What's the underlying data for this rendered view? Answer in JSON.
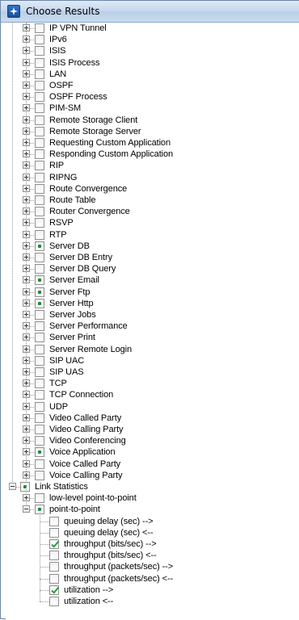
{
  "window": {
    "title": "Choose Results",
    "icon": "app-window-icon"
  },
  "tree": {
    "results": [
      {
        "label": "IP VPN Tunnel",
        "state": "unchecked"
      },
      {
        "label": "IPv6",
        "state": "unchecked"
      },
      {
        "label": "ISIS",
        "state": "unchecked"
      },
      {
        "label": "ISIS Process",
        "state": "unchecked"
      },
      {
        "label": "LAN",
        "state": "unchecked"
      },
      {
        "label": "OSPF",
        "state": "unchecked"
      },
      {
        "label": "OSPF Process",
        "state": "unchecked"
      },
      {
        "label": "PIM-SM",
        "state": "unchecked"
      },
      {
        "label": "Remote Storage Client",
        "state": "unchecked"
      },
      {
        "label": "Remote Storage Server",
        "state": "unchecked"
      },
      {
        "label": "Requesting Custom Application",
        "state": "unchecked"
      },
      {
        "label": "Responding Custom Application",
        "state": "unchecked"
      },
      {
        "label": "RIP",
        "state": "unchecked"
      },
      {
        "label": "RIPNG",
        "state": "unchecked"
      },
      {
        "label": "Route Convergence",
        "state": "unchecked"
      },
      {
        "label": "Route Table",
        "state": "unchecked"
      },
      {
        "label": "Router Convergence",
        "state": "unchecked"
      },
      {
        "label": "RSVP",
        "state": "unchecked"
      },
      {
        "label": "RTP",
        "state": "unchecked"
      },
      {
        "label": "Server DB",
        "state": "partial"
      },
      {
        "label": "Server DB Entry",
        "state": "unchecked"
      },
      {
        "label": "Server DB Query",
        "state": "unchecked"
      },
      {
        "label": "Server Email",
        "state": "partial"
      },
      {
        "label": "Server Ftp",
        "state": "partial"
      },
      {
        "label": "Server Http",
        "state": "partial"
      },
      {
        "label": "Server Jobs",
        "state": "unchecked"
      },
      {
        "label": "Server Performance",
        "state": "unchecked"
      },
      {
        "label": "Server Print",
        "state": "unchecked"
      },
      {
        "label": "Server Remote Login",
        "state": "unchecked"
      },
      {
        "label": "SIP UAC",
        "state": "unchecked"
      },
      {
        "label": "SIP UAS",
        "state": "unchecked"
      },
      {
        "label": "TCP",
        "state": "unchecked"
      },
      {
        "label": "TCP Connection",
        "state": "unchecked"
      },
      {
        "label": "UDP",
        "state": "unchecked"
      },
      {
        "label": "Video Called Party",
        "state": "unchecked"
      },
      {
        "label": "Video Calling Party",
        "state": "unchecked"
      },
      {
        "label": "Video Conferencing",
        "state": "unchecked"
      },
      {
        "label": "Voice Application",
        "state": "partial"
      },
      {
        "label": "Voice Called Party",
        "state": "unchecked"
      },
      {
        "label": "Voice Calling Party",
        "state": "unchecked"
      }
    ],
    "link_statistics": {
      "label": "Link Statistics",
      "state": "partial",
      "children": [
        {
          "label": "low-level point-to-point",
          "state": "unchecked"
        },
        {
          "label": "point-to-point",
          "state": "partial"
        }
      ],
      "point_to_point_stats": [
        {
          "label": "queuing delay (sec) -->",
          "state": "unchecked"
        },
        {
          "label": "queuing delay (sec) <--",
          "state": "unchecked"
        },
        {
          "label": "throughput (bits/sec) -->",
          "state": "checked"
        },
        {
          "label": "throughput (bits/sec) <--",
          "state": "unchecked"
        },
        {
          "label": "throughput (packets/sec) -->",
          "state": "unchecked"
        },
        {
          "label": "throughput (packets/sec) <--",
          "state": "unchecked"
        },
        {
          "label": "utilization -->",
          "state": "checked"
        },
        {
          "label": "utilization <--",
          "state": "unchecked"
        }
      ]
    }
  },
  "colors": {
    "partial_mark": "#1c8a3a",
    "check_mark": "#2e9a3e",
    "titlebar": "#c7d9ee"
  }
}
